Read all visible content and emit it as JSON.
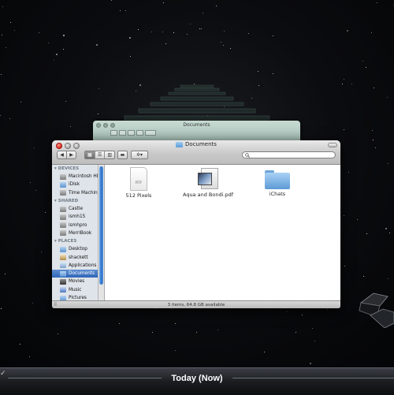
{
  "back_window": {
    "title": "Documents"
  },
  "window": {
    "title": "Documents",
    "toolbar": {
      "back_icon": "◀",
      "forward_icon": "▶",
      "view_icons": [
        "▦",
        "☰",
        "▥"
      ],
      "coverflow_icon": "▬",
      "action_icon": "✲▾",
      "search_placeholder": ""
    },
    "sidebar": {
      "sections": [
        {
          "header": "DEVICES",
          "items": [
            {
              "label": "Macintosh HD",
              "icon": "hard-disk-icon"
            },
            {
              "label": "iDisk",
              "icon": "idisk-icon"
            },
            {
              "label": "Time Machine",
              "icon": "time-machine-disk-icon"
            }
          ]
        },
        {
          "header": "SHARED",
          "items": [
            {
              "label": "Castle",
              "icon": "computer-icon"
            },
            {
              "label": "ismh15",
              "icon": "computer-icon"
            },
            {
              "label": "ismhpro",
              "icon": "computer-icon"
            },
            {
              "label": "MerriBook",
              "icon": "computer-icon"
            }
          ]
        },
        {
          "header": "PLACES",
          "items": [
            {
              "label": "Desktop",
              "icon": "desktop-icon"
            },
            {
              "label": "shackett",
              "icon": "home-icon"
            },
            {
              "label": "Applications",
              "icon": "applications-icon"
            },
            {
              "label": "Documents",
              "icon": "documents-folder-icon",
              "selected": true
            },
            {
              "label": "Movies",
              "icon": "movies-icon"
            },
            {
              "label": "Music",
              "icon": "music-icon"
            },
            {
              "label": "Pictures",
              "icon": "pictures-icon"
            }
          ]
        }
      ]
    },
    "files": [
      {
        "name": "512 Pixels",
        "kind": "rtf",
        "badge": "RTF"
      },
      {
        "name": "Aqua and Bondi.pdf",
        "kind": "pdf"
      },
      {
        "name": "iChats",
        "kind": "folder"
      }
    ],
    "status": "3 items, 64.8 GB available"
  },
  "timeline": {
    "label": "Today (Now)"
  },
  "colors": {
    "selection": "#2f65b8",
    "close_button": "#d8271b",
    "folder": "#5d9bd6"
  }
}
